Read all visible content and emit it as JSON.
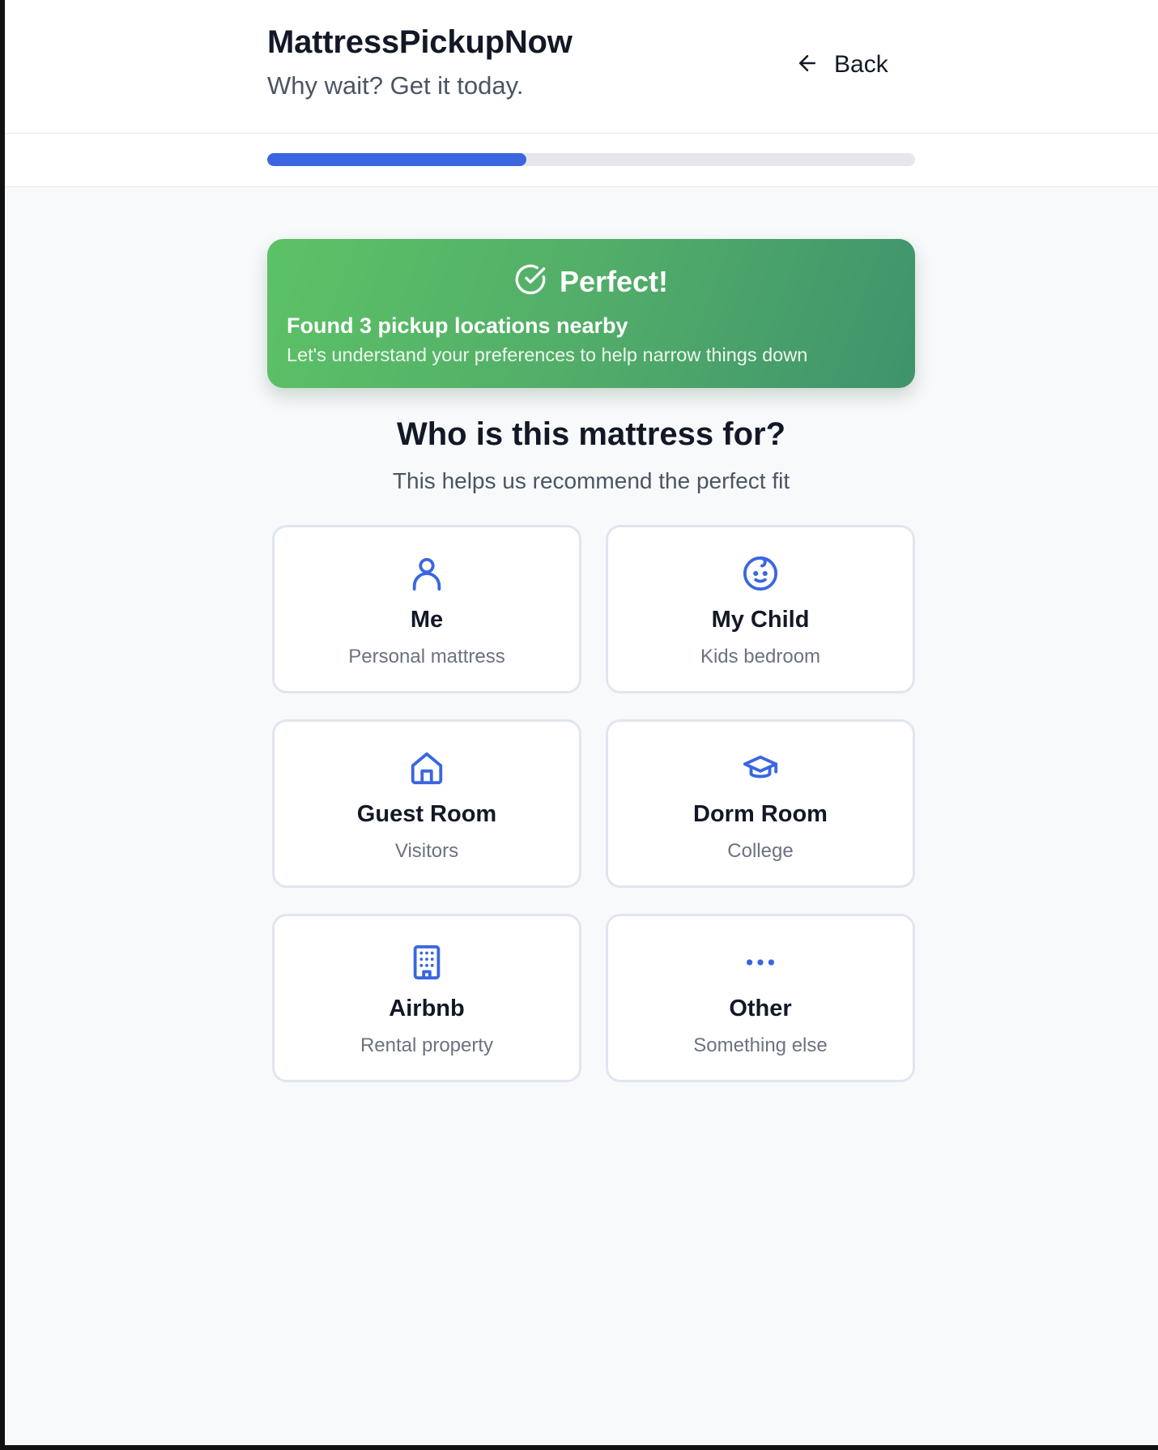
{
  "header": {
    "brand": "MattressPickupNow",
    "tagline": "Why wait? Get it today.",
    "back_label": "Back",
    "back_icon": "arrow-left-icon"
  },
  "progress": {
    "fraction": 0.4
  },
  "banner": {
    "icon": "check-circle-icon",
    "title": "Perfect!",
    "subtitle": "Found 3 pickup locations nearby",
    "detail": "Let's understand your preferences to help narrow things down",
    "gradient": [
      "#5cc266",
      "#3f936c"
    ]
  },
  "question": {
    "title": "Who is this mattress for?",
    "subtitle": "This helps us recommend the perfect fit"
  },
  "options": [
    {
      "title": "Me",
      "subtitle": "Personal mattress",
      "icon": "user-icon"
    },
    {
      "title": "My Child",
      "subtitle": "Kids bedroom",
      "icon": "baby-face-icon"
    },
    {
      "title": "Guest Room",
      "subtitle": "Visitors",
      "icon": "home-icon"
    },
    {
      "title": "Dorm Room",
      "subtitle": "College",
      "icon": "graduation-cap-icon"
    },
    {
      "title": "Airbnb",
      "subtitle": "Rental property",
      "icon": "building-icon"
    },
    {
      "title": "Other",
      "subtitle": "Something else",
      "icon": "more-dots-icon"
    }
  ],
  "colors": {
    "accent": "#3b66e0",
    "icon": "#3b66e0",
    "track": "#e5e7eb",
    "text_dark": "#121826",
    "text_muted": "#6b7280"
  }
}
